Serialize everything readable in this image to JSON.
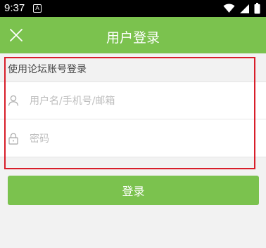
{
  "status_bar": {
    "time": "9:37",
    "notification_glyph": "A",
    "icons": [
      "wifi-icon",
      "signal-icon",
      "battery-icon"
    ]
  },
  "app_bar": {
    "title": "用户登录",
    "close_icon": "close-icon",
    "color": "#7bc24e"
  },
  "login_form": {
    "section_label": "使用论坛账号登录",
    "username": {
      "placeholder": "用户名/手机号/邮箱",
      "value": "",
      "icon": "user-icon"
    },
    "password": {
      "placeholder": "密码",
      "value": "",
      "icon": "lock-icon"
    },
    "submit_label": "登录"
  },
  "colors": {
    "accent": "#7bc24e",
    "highlight": "#d81e2a"
  }
}
